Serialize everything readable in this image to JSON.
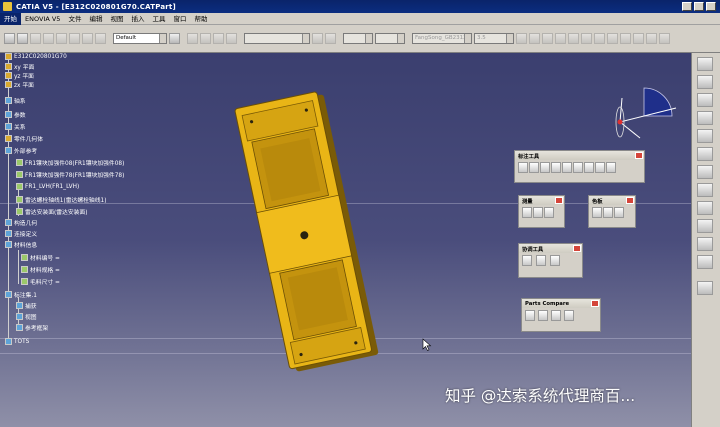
{
  "window": {
    "title": "CATIA V5 - [E312C020801G70.CATPart]"
  },
  "menu": {
    "items": [
      "开始",
      "ENOVIA V5",
      "文件",
      "编辑",
      "视图",
      "插入",
      "工具",
      "窗口",
      "帮助"
    ]
  },
  "toolbar": {
    "style_combo": "Default",
    "layer_combo": "",
    "color_combo": "",
    "linetype_combo": "",
    "font_combo": "FangSong_GB2312",
    "size_combo": "3.5"
  },
  "tree": {
    "root": "E312C020801G70",
    "nodes": [
      "xy 平面",
      "yz 平面",
      "zx 平面",
      "轴系",
      "参数",
      "关系",
      "零件几何体",
      "外部参考",
      "FR1镶块加强件08(FR1镶块加强件08)",
      "FR1镶块加强件78(FR1镶块加强件78)",
      "FR1_LVH(FR1_LVH)",
      "雷达螺栓轴线1(雷达螺栓轴线1)",
      "雷达安装面(雷达安装面)",
      "构造几何",
      "连接定义",
      "材料信息",
      "材料编号 =",
      "材料规格 =",
      "毛料尺寸 =",
      "标注集.1",
      "捕获",
      "视图",
      "参考框架",
      "TOTS"
    ]
  },
  "panels": {
    "annotation_tools": "标注工具",
    "measure": "测量",
    "color": "色板",
    "assist_tools": "协调工具",
    "parts_compare": "Parts Compare"
  },
  "watermark": "知乎 @达索系统代理商百..."
}
